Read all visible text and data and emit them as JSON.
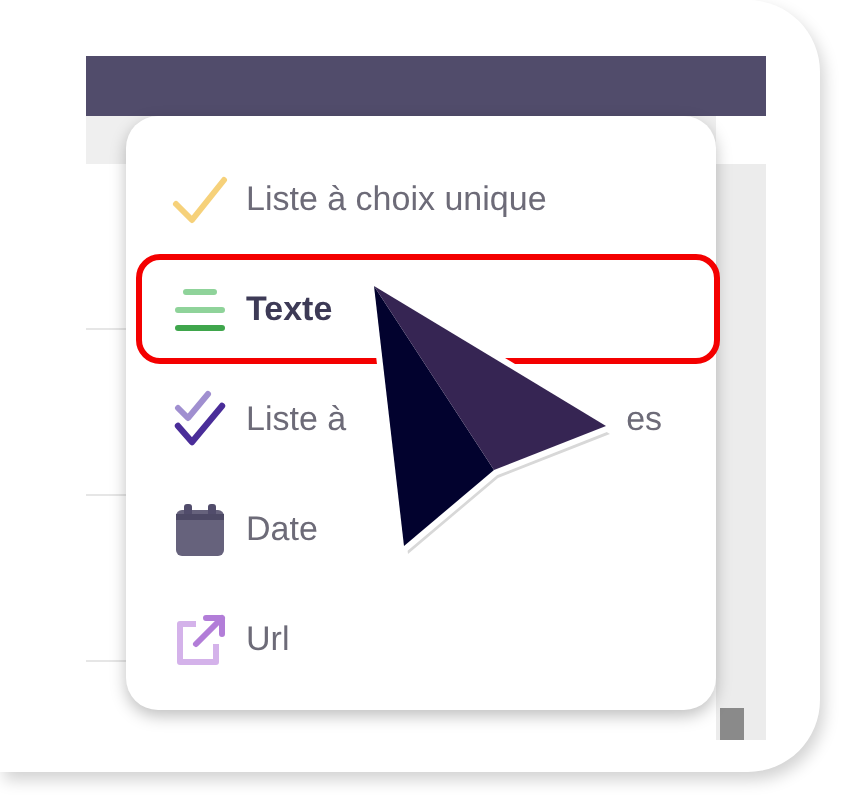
{
  "menu": {
    "items": [
      {
        "kind": "single-choice",
        "label": "Liste à choix unique",
        "selected": false
      },
      {
        "kind": "text",
        "label": "Texte",
        "selected": true
      },
      {
        "kind": "multiple-choice",
        "label": "Liste à",
        "label_tail": "es",
        "selected": false
      },
      {
        "kind": "date",
        "label": "Date",
        "selected": false
      },
      {
        "kind": "url",
        "label": "Url",
        "selected": false
      }
    ]
  }
}
